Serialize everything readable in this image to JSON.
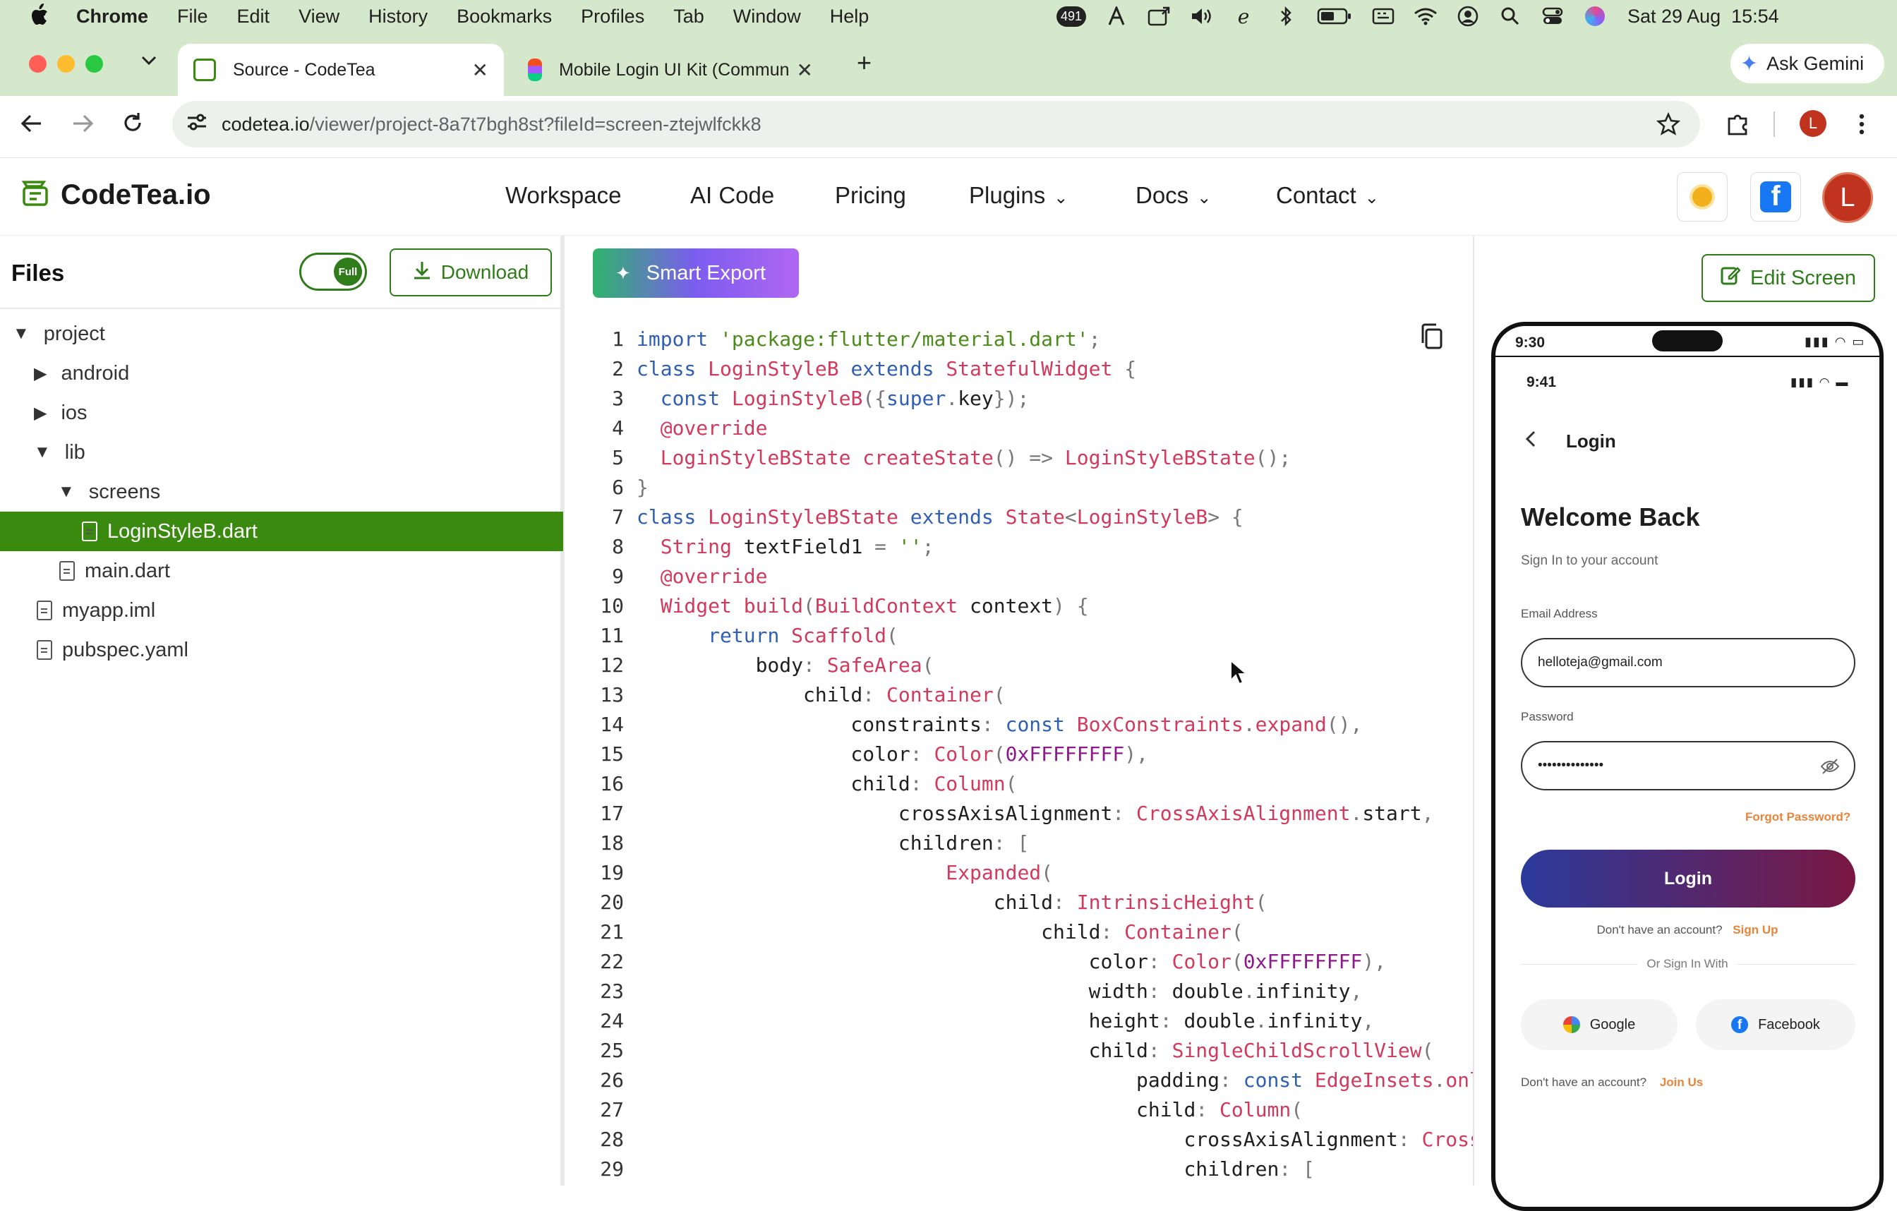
{
  "menubar": {
    "app": "Chrome",
    "items": [
      "File",
      "Edit",
      "View",
      "History",
      "Bookmarks",
      "Profiles",
      "Tab",
      "Window",
      "Help"
    ],
    "notification_count": "491",
    "datetime": "Sat 29 Aug  15:54"
  },
  "tabs": [
    {
      "title": "Source - CodeTea",
      "active": true
    },
    {
      "title": "Mobile Login UI Kit (Commun",
      "active": false
    }
  ],
  "ask_gemini": "Ask Gemini",
  "address": {
    "host": "codetea.io",
    "path": "/viewer/project-8a7t7bgh8st?fileId=screen-ztejwlfckk8"
  },
  "profile_initial": "L",
  "site": {
    "logo": "CodeTea.io",
    "nav": [
      "Workspace",
      "AI Code",
      "Pricing",
      "Plugins",
      "Docs",
      "Contact"
    ],
    "avatar": "L"
  },
  "files_panel": {
    "title": "Files",
    "toggle_label": "Full",
    "download_label": "Download",
    "tree": [
      {
        "label": "project",
        "kind": "folder-open",
        "depth": 0
      },
      {
        "label": "android",
        "kind": "folder-closed",
        "depth": 1
      },
      {
        "label": "ios",
        "kind": "folder-closed",
        "depth": 1
      },
      {
        "label": "lib",
        "kind": "folder-open",
        "depth": 1
      },
      {
        "label": "screens",
        "kind": "folder-open",
        "depth": 2
      },
      {
        "label": "LoginStyleB.dart",
        "kind": "file",
        "depth": 3,
        "selected": true
      },
      {
        "label": "main.dart",
        "kind": "file",
        "depth": 2
      },
      {
        "label": "myapp.iml",
        "kind": "file",
        "depth": 1
      },
      {
        "label": "pubspec.yaml",
        "kind": "file",
        "depth": 1
      }
    ]
  },
  "smart_export_label": "Smart Export",
  "edit_screen_label": "Edit Screen",
  "code_lines": [
    [
      [
        "kw",
        "import "
      ],
      [
        "st",
        "'package:flutter/material.dart'"
      ],
      [
        "pu",
        ";"
      ]
    ],
    [
      [
        "kw",
        "class "
      ],
      [
        "ty",
        "LoginStyleB "
      ],
      [
        "kw",
        "extends "
      ],
      [
        "ty",
        "StatefulWidget "
      ],
      [
        "pu",
        "{"
      ]
    ],
    [
      [
        "id",
        "  "
      ],
      [
        "kw",
        "const "
      ],
      [
        "ty",
        "LoginStyleB"
      ],
      [
        "pu",
        "({"
      ],
      [
        "kw",
        "super"
      ],
      [
        "pu",
        "."
      ],
      [
        "id",
        "key"
      ],
      [
        "pu",
        "});"
      ]
    ],
    [
      [
        "id",
        "  "
      ],
      [
        "an",
        "@override"
      ]
    ],
    [
      [
        "id",
        "  "
      ],
      [
        "ty",
        "LoginStyleBState createState"
      ],
      [
        "pu",
        "() => "
      ],
      [
        "ty",
        "LoginStyleBState"
      ],
      [
        "pu",
        "();"
      ]
    ],
    [
      [
        "pu",
        "}"
      ]
    ],
    [
      [
        "kw",
        "class "
      ],
      [
        "ty",
        "LoginStyleBState "
      ],
      [
        "kw",
        "extends "
      ],
      [
        "ty",
        "State"
      ],
      [
        "pu",
        "<"
      ],
      [
        "ty",
        "LoginStyleB"
      ],
      [
        "pu",
        "> {"
      ]
    ],
    [
      [
        "id",
        "  "
      ],
      [
        "ty",
        "String "
      ],
      [
        "id",
        "textField1 "
      ],
      [
        "pu",
        "= "
      ],
      [
        "st",
        "''"
      ],
      [
        "pu",
        ";"
      ]
    ],
    [
      [
        "id",
        "  "
      ],
      [
        "an",
        "@override"
      ]
    ],
    [
      [
        "id",
        "  "
      ],
      [
        "ty",
        "Widget build"
      ],
      [
        "pu",
        "("
      ],
      [
        "ty",
        "BuildContext "
      ],
      [
        "id",
        "context"
      ],
      [
        "pu",
        ") {"
      ]
    ],
    [
      [
        "id",
        "      "
      ],
      [
        "kw",
        "return "
      ],
      [
        "ty",
        "Scaffold"
      ],
      [
        "pu",
        "("
      ]
    ],
    [
      [
        "id",
        "          body"
      ],
      [
        "pu",
        ": "
      ],
      [
        "ty",
        "SafeArea"
      ],
      [
        "pu",
        "("
      ]
    ],
    [
      [
        "id",
        "              child"
      ],
      [
        "pu",
        ": "
      ],
      [
        "ty",
        "Container"
      ],
      [
        "pu",
        "("
      ]
    ],
    [
      [
        "id",
        "                  constraints"
      ],
      [
        "pu",
        ": "
      ],
      [
        "kw",
        "const "
      ],
      [
        "ty",
        "BoxConstraints"
      ],
      [
        "pu",
        "."
      ],
      [
        "ty",
        "expand"
      ],
      [
        "pu",
        "(),"
      ]
    ],
    [
      [
        "id",
        "                  color"
      ],
      [
        "pu",
        ": "
      ],
      [
        "ty",
        "Color"
      ],
      [
        "pu",
        "("
      ],
      [
        "nm",
        "0xFFFFFFFF"
      ],
      [
        "pu",
        "),"
      ]
    ],
    [
      [
        "id",
        "                  child"
      ],
      [
        "pu",
        ": "
      ],
      [
        "ty",
        "Column"
      ],
      [
        "pu",
        "("
      ]
    ],
    [
      [
        "id",
        "                      crossAxisAlignment"
      ],
      [
        "pu",
        ": "
      ],
      [
        "ty",
        "CrossAxisAlignment"
      ],
      [
        "pu",
        "."
      ],
      [
        "id",
        "start"
      ],
      [
        "pu",
        ","
      ]
    ],
    [
      [
        "id",
        "                      children"
      ],
      [
        "pu",
        ": ["
      ]
    ],
    [
      [
        "id",
        "                          "
      ],
      [
        "ty",
        "Expanded"
      ],
      [
        "pu",
        "("
      ]
    ],
    [
      [
        "id",
        "                              child"
      ],
      [
        "pu",
        ": "
      ],
      [
        "ty",
        "IntrinsicHeight"
      ],
      [
        "pu",
        "("
      ]
    ],
    [
      [
        "id",
        "                                  child"
      ],
      [
        "pu",
        ": "
      ],
      [
        "ty",
        "Container"
      ],
      [
        "pu",
        "("
      ]
    ],
    [
      [
        "id",
        "                                      color"
      ],
      [
        "pu",
        ": "
      ],
      [
        "ty",
        "Color"
      ],
      [
        "pu",
        "("
      ],
      [
        "nm",
        "0xFFFFFFFF"
      ],
      [
        "pu",
        "),"
      ]
    ],
    [
      [
        "id",
        "                                      width"
      ],
      [
        "pu",
        ": "
      ],
      [
        "id",
        "double"
      ],
      [
        "pu",
        "."
      ],
      [
        "id",
        "infinity"
      ],
      [
        "pu",
        ","
      ]
    ],
    [
      [
        "id",
        "                                      height"
      ],
      [
        "pu",
        ": "
      ],
      [
        "id",
        "double"
      ],
      [
        "pu",
        "."
      ],
      [
        "id",
        "infinity"
      ],
      [
        "pu",
        ","
      ]
    ],
    [
      [
        "id",
        "                                      child"
      ],
      [
        "pu",
        ": "
      ],
      [
        "ty",
        "SingleChildScrollView"
      ],
      [
        "pu",
        "("
      ]
    ],
    [
      [
        "id",
        "                                          padding"
      ],
      [
        "pu",
        ": "
      ],
      [
        "kw",
        "const "
      ],
      [
        "ty",
        "EdgeInsets"
      ],
      [
        "pu",
        "."
      ],
      [
        "ty",
        "only"
      ],
      [
        "pu",
        "("
      ]
    ],
    [
      [
        "id",
        "                                          child"
      ],
      [
        "pu",
        ": "
      ],
      [
        "ty",
        "Column"
      ],
      [
        "pu",
        "("
      ]
    ],
    [
      [
        "id",
        "                                              crossAxisAlignment"
      ],
      [
        "pu",
        ": "
      ],
      [
        "ty",
        "CrossAxisAlignment"
      ],
      [
        "pu",
        "."
      ]
    ],
    [
      [
        "id",
        "                                              children"
      ],
      [
        "pu",
        ": ["
      ]
    ]
  ],
  "phone": {
    "outer_time": "9:30",
    "inner_time": "9:41",
    "header_title": "Login",
    "welcome": "Welcome Back",
    "subtitle": "Sign In to your account",
    "email_label": "Email Address",
    "email_value": "helloteja@gmail.com",
    "password_label": "Password",
    "password_value": "••••••••••••••",
    "forgot": "Forgot Password?",
    "login_button": "Login",
    "no_account": "Don't have an account?",
    "sign_up": "Sign Up",
    "or_sign_in": "Or Sign In With",
    "google": "Google",
    "facebook": "Facebook",
    "no_account2": "Don't have an account?",
    "join_us": "Join Us"
  },
  "colors": {
    "chrome_frame": "#d6e8cc",
    "selected_file": "#3a8a0f",
    "accent_green": "#2f7d1a",
    "forgot_orange": "#e8853a",
    "login_gradient_start": "#2b3a9c",
    "login_gradient_end": "#7a1742"
  }
}
